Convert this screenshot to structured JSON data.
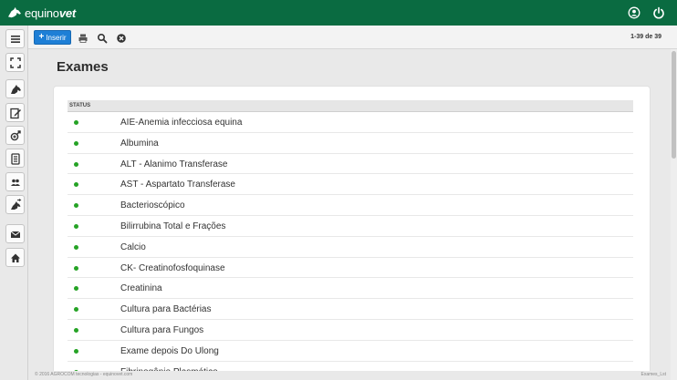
{
  "app": {
    "logo_part1": "equino",
    "logo_part2": "vet"
  },
  "toolbar": {
    "insert_label": "Inserir",
    "pager_text": "1-39 de 39"
  },
  "page": {
    "title": "Exames"
  },
  "table": {
    "header_status": "STATUS",
    "rows": [
      {
        "status": "active",
        "name": "AIE-Anemia infecciosa equina"
      },
      {
        "status": "active",
        "name": "Albumina"
      },
      {
        "status": "active",
        "name": "ALT - Alanimo Transferase"
      },
      {
        "status": "active",
        "name": "AST - Aspartato Transferase"
      },
      {
        "status": "active",
        "name": "Bacterioscópico"
      },
      {
        "status": "active",
        "name": "Bilirrubina Total e Frações"
      },
      {
        "status": "active",
        "name": "Calcio"
      },
      {
        "status": "active",
        "name": "CK- Creatinofosfoquinase"
      },
      {
        "status": "active",
        "name": "Creatinina"
      },
      {
        "status": "active",
        "name": "Cultura para Bactérias"
      },
      {
        "status": "active",
        "name": "Cultura para Fungos"
      },
      {
        "status": "active",
        "name": "Exame depois Do Ulong"
      },
      {
        "status": "active",
        "name": "Fibrinogênio Plasmático"
      }
    ]
  },
  "footer": {
    "left": "© 2016 AGROCOM tecnologias - equinovet.com",
    "right": "Exames_Lst"
  },
  "colors": {
    "topbar": "#0a6b41",
    "accent_button": "#1e7fd6",
    "status_active": "#25a325"
  },
  "icons": {
    "sidebar": [
      "menu-icon",
      "fullscreen-icon",
      "horse-icon",
      "edit-document-icon",
      "gender-icon",
      "clipboard-icon",
      "users-icon",
      "horse-transfer-icon",
      "mail-icon",
      "home-icon"
    ],
    "toolbar": [
      "print-icon",
      "search-icon",
      "clear-filter-icon"
    ],
    "topbar": [
      "user-icon",
      "power-icon"
    ]
  }
}
